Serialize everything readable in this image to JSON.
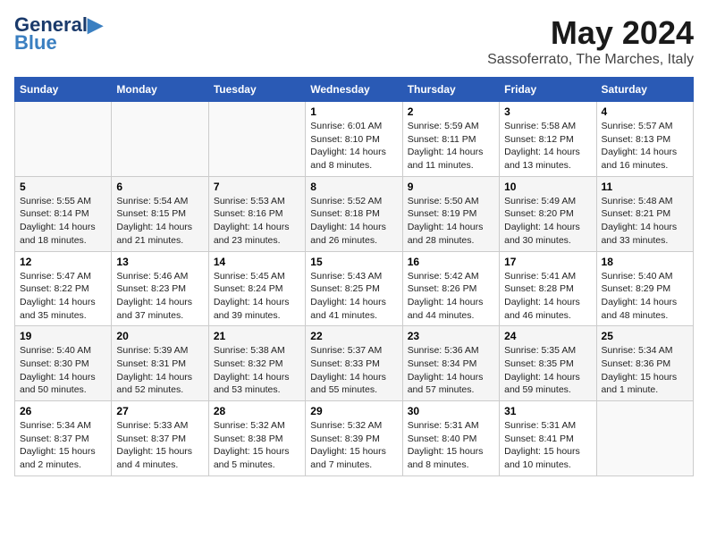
{
  "logo": {
    "line1": "General",
    "line2": "Blue"
  },
  "title": "May 2024",
  "subtitle": "Sassoferrato, The Marches, Italy",
  "headers": [
    "Sunday",
    "Monday",
    "Tuesday",
    "Wednesday",
    "Thursday",
    "Friday",
    "Saturday"
  ],
  "weeks": [
    [
      {
        "day": "",
        "info": ""
      },
      {
        "day": "",
        "info": ""
      },
      {
        "day": "",
        "info": ""
      },
      {
        "day": "1",
        "info": "Sunrise: 6:01 AM\nSunset: 8:10 PM\nDaylight: 14 hours\nand 8 minutes."
      },
      {
        "day": "2",
        "info": "Sunrise: 5:59 AM\nSunset: 8:11 PM\nDaylight: 14 hours\nand 11 minutes."
      },
      {
        "day": "3",
        "info": "Sunrise: 5:58 AM\nSunset: 8:12 PM\nDaylight: 14 hours\nand 13 minutes."
      },
      {
        "day": "4",
        "info": "Sunrise: 5:57 AM\nSunset: 8:13 PM\nDaylight: 14 hours\nand 16 minutes."
      }
    ],
    [
      {
        "day": "5",
        "info": "Sunrise: 5:55 AM\nSunset: 8:14 PM\nDaylight: 14 hours\nand 18 minutes."
      },
      {
        "day": "6",
        "info": "Sunrise: 5:54 AM\nSunset: 8:15 PM\nDaylight: 14 hours\nand 21 minutes."
      },
      {
        "day": "7",
        "info": "Sunrise: 5:53 AM\nSunset: 8:16 PM\nDaylight: 14 hours\nand 23 minutes."
      },
      {
        "day": "8",
        "info": "Sunrise: 5:52 AM\nSunset: 8:18 PM\nDaylight: 14 hours\nand 26 minutes."
      },
      {
        "day": "9",
        "info": "Sunrise: 5:50 AM\nSunset: 8:19 PM\nDaylight: 14 hours\nand 28 minutes."
      },
      {
        "day": "10",
        "info": "Sunrise: 5:49 AM\nSunset: 8:20 PM\nDaylight: 14 hours\nand 30 minutes."
      },
      {
        "day": "11",
        "info": "Sunrise: 5:48 AM\nSunset: 8:21 PM\nDaylight: 14 hours\nand 33 minutes."
      }
    ],
    [
      {
        "day": "12",
        "info": "Sunrise: 5:47 AM\nSunset: 8:22 PM\nDaylight: 14 hours\nand 35 minutes."
      },
      {
        "day": "13",
        "info": "Sunrise: 5:46 AM\nSunset: 8:23 PM\nDaylight: 14 hours\nand 37 minutes."
      },
      {
        "day": "14",
        "info": "Sunrise: 5:45 AM\nSunset: 8:24 PM\nDaylight: 14 hours\nand 39 minutes."
      },
      {
        "day": "15",
        "info": "Sunrise: 5:43 AM\nSunset: 8:25 PM\nDaylight: 14 hours\nand 41 minutes."
      },
      {
        "day": "16",
        "info": "Sunrise: 5:42 AM\nSunset: 8:26 PM\nDaylight: 14 hours\nand 44 minutes."
      },
      {
        "day": "17",
        "info": "Sunrise: 5:41 AM\nSunset: 8:28 PM\nDaylight: 14 hours\nand 46 minutes."
      },
      {
        "day": "18",
        "info": "Sunrise: 5:40 AM\nSunset: 8:29 PM\nDaylight: 14 hours\nand 48 minutes."
      }
    ],
    [
      {
        "day": "19",
        "info": "Sunrise: 5:40 AM\nSunset: 8:30 PM\nDaylight: 14 hours\nand 50 minutes."
      },
      {
        "day": "20",
        "info": "Sunrise: 5:39 AM\nSunset: 8:31 PM\nDaylight: 14 hours\nand 52 minutes."
      },
      {
        "day": "21",
        "info": "Sunrise: 5:38 AM\nSunset: 8:32 PM\nDaylight: 14 hours\nand 53 minutes."
      },
      {
        "day": "22",
        "info": "Sunrise: 5:37 AM\nSunset: 8:33 PM\nDaylight: 14 hours\nand 55 minutes."
      },
      {
        "day": "23",
        "info": "Sunrise: 5:36 AM\nSunset: 8:34 PM\nDaylight: 14 hours\nand 57 minutes."
      },
      {
        "day": "24",
        "info": "Sunrise: 5:35 AM\nSunset: 8:35 PM\nDaylight: 14 hours\nand 59 minutes."
      },
      {
        "day": "25",
        "info": "Sunrise: 5:34 AM\nSunset: 8:36 PM\nDaylight: 15 hours\nand 1 minute."
      }
    ],
    [
      {
        "day": "26",
        "info": "Sunrise: 5:34 AM\nSunset: 8:37 PM\nDaylight: 15 hours\nand 2 minutes."
      },
      {
        "day": "27",
        "info": "Sunrise: 5:33 AM\nSunset: 8:37 PM\nDaylight: 15 hours\nand 4 minutes."
      },
      {
        "day": "28",
        "info": "Sunrise: 5:32 AM\nSunset: 8:38 PM\nDaylight: 15 hours\nand 5 minutes."
      },
      {
        "day": "29",
        "info": "Sunrise: 5:32 AM\nSunset: 8:39 PM\nDaylight: 15 hours\nand 7 minutes."
      },
      {
        "day": "30",
        "info": "Sunrise: 5:31 AM\nSunset: 8:40 PM\nDaylight: 15 hours\nand 8 minutes."
      },
      {
        "day": "31",
        "info": "Sunrise: 5:31 AM\nSunset: 8:41 PM\nDaylight: 15 hours\nand 10 minutes."
      },
      {
        "day": "",
        "info": ""
      }
    ]
  ]
}
